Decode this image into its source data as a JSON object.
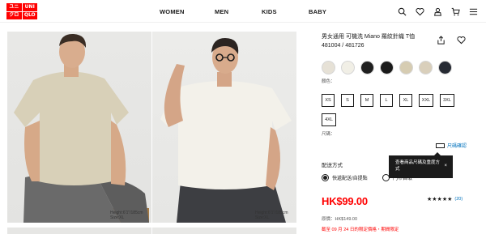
{
  "header": {
    "logo": [
      "ユニ",
      "UNI",
      "クロ",
      "QLO"
    ],
    "nav": [
      "WOMEN",
      "MEN",
      "KIDS",
      "BABY"
    ],
    "icons": [
      "search-icon",
      "heart-icon",
      "user-icon",
      "cart-icon",
      "menu-icon"
    ]
  },
  "gallery": {
    "caption1_height": "Height:6'1\"/185cm",
    "caption1_size": "Size:XL",
    "caption2_height": "Height:6'1\"/185cm",
    "caption2_size": "Size:XL"
  },
  "product": {
    "title": "男女通用 可機洗 Miano 羅紋針織 T恤 481004 / 481726",
    "color_label": "顏色：",
    "colors": [
      "#e6e1d6",
      "#f1efe6",
      "#1f1f1f",
      "#1a1a1a",
      "#d6ccb2",
      "#d9cfbb",
      "#262a33"
    ],
    "sizes_row1": [
      "XS",
      "S",
      "M",
      "L",
      "XL",
      "XXL",
      "3XL"
    ],
    "sizes_row2": [
      "4XL"
    ],
    "size_label": "尺碼：",
    "size_chart_link": "尺碼確認",
    "tooltip_text": "查看商品尺碼及重度方式",
    "tooltip_close": "×",
    "shipping_label": "配送方式",
    "shipping_option1": "快遞配送/自提點",
    "shipping_option2": "門市自取",
    "price": "HK$99.00",
    "rating_stars": "★★★★★",
    "review_count": "(20)",
    "original_price": "原價：HK$149.00",
    "promo_text": "截至 09 月 24 日的限定價格・期間限定"
  }
}
